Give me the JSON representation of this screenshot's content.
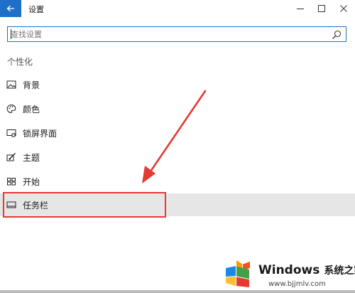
{
  "window": {
    "title": "设置",
    "back_icon": "arrow-left-icon",
    "controls": [
      "minimize-icon",
      "maximize-icon",
      "close-icon"
    ]
  },
  "search": {
    "placeholder": "查找设置",
    "value": "",
    "icon": "search-icon"
  },
  "section": {
    "title": "个性化"
  },
  "nav": {
    "items": [
      {
        "label": "背景",
        "icon": "picture-icon"
      },
      {
        "label": "颜色",
        "icon": "palette-icon"
      },
      {
        "label": "锁屏界面",
        "icon": "lock-screen-icon"
      },
      {
        "label": "主题",
        "icon": "theme-brush-icon"
      },
      {
        "label": "开始",
        "icon": "start-grid-icon"
      },
      {
        "label": "任务栏",
        "icon": "taskbar-icon",
        "selected": true
      }
    ]
  },
  "annotation": {
    "highlight_color": "#e53935",
    "arrow_color": "#e53935"
  },
  "watermark": {
    "brand": "Windows",
    "brand_cn": "系统之家",
    "url": "www.bjjmlv.com"
  },
  "colors": {
    "accent": "#1e6fc8",
    "selected_bg": "#e6e6e6"
  }
}
